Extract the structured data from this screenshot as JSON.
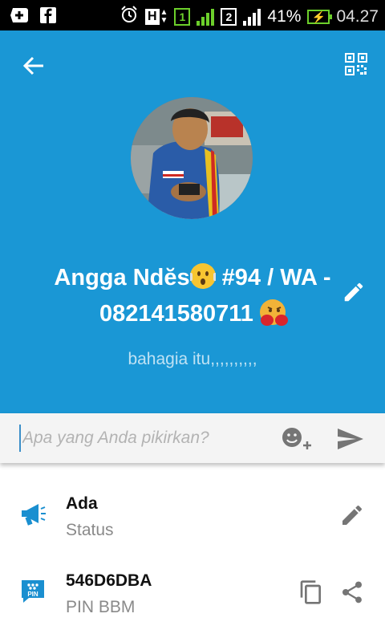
{
  "status_bar": {
    "sim1": "1",
    "sim2": "2",
    "network": "H",
    "battery_percent": "41%",
    "time": "04.27",
    "icons": [
      "add-icon",
      "facebook-icon",
      "alarm-icon",
      "network-h-icon",
      "sim1-signal-icon",
      "sim2-signal-icon",
      "battery-charging-icon"
    ]
  },
  "header": {
    "icons": [
      "back-arrow-icon",
      "qr-code-icon",
      "edit-pencil-icon"
    ],
    "name_part1": "Angga Ndĕs",
    "name_part2": " #94 / WA -",
    "name_part3": "082141580711",
    "personal_message": "bahagia itu,,,,,,,,,,"
  },
  "composer": {
    "placeholder": "Apa yang Anda pikirkan?",
    "value": "",
    "icons": [
      "emoji-add-icon",
      "send-icon"
    ]
  },
  "details": [
    {
      "title": "Ada",
      "subtitle": "Status",
      "icon": "megaphone-icon",
      "action_icon": "edit-pencil-icon"
    },
    {
      "title": "546D6DBA",
      "subtitle": "PIN BBM",
      "icon": "pin-icon",
      "pin_label": "PIN",
      "action_icons": [
        "copy-icon",
        "share-icon"
      ]
    }
  ],
  "colors": {
    "header_blue": "#1a97d5",
    "accent_blue": "#1a8fd0",
    "icon_gray": "#757575",
    "signal_green": "#6ccf2b"
  }
}
